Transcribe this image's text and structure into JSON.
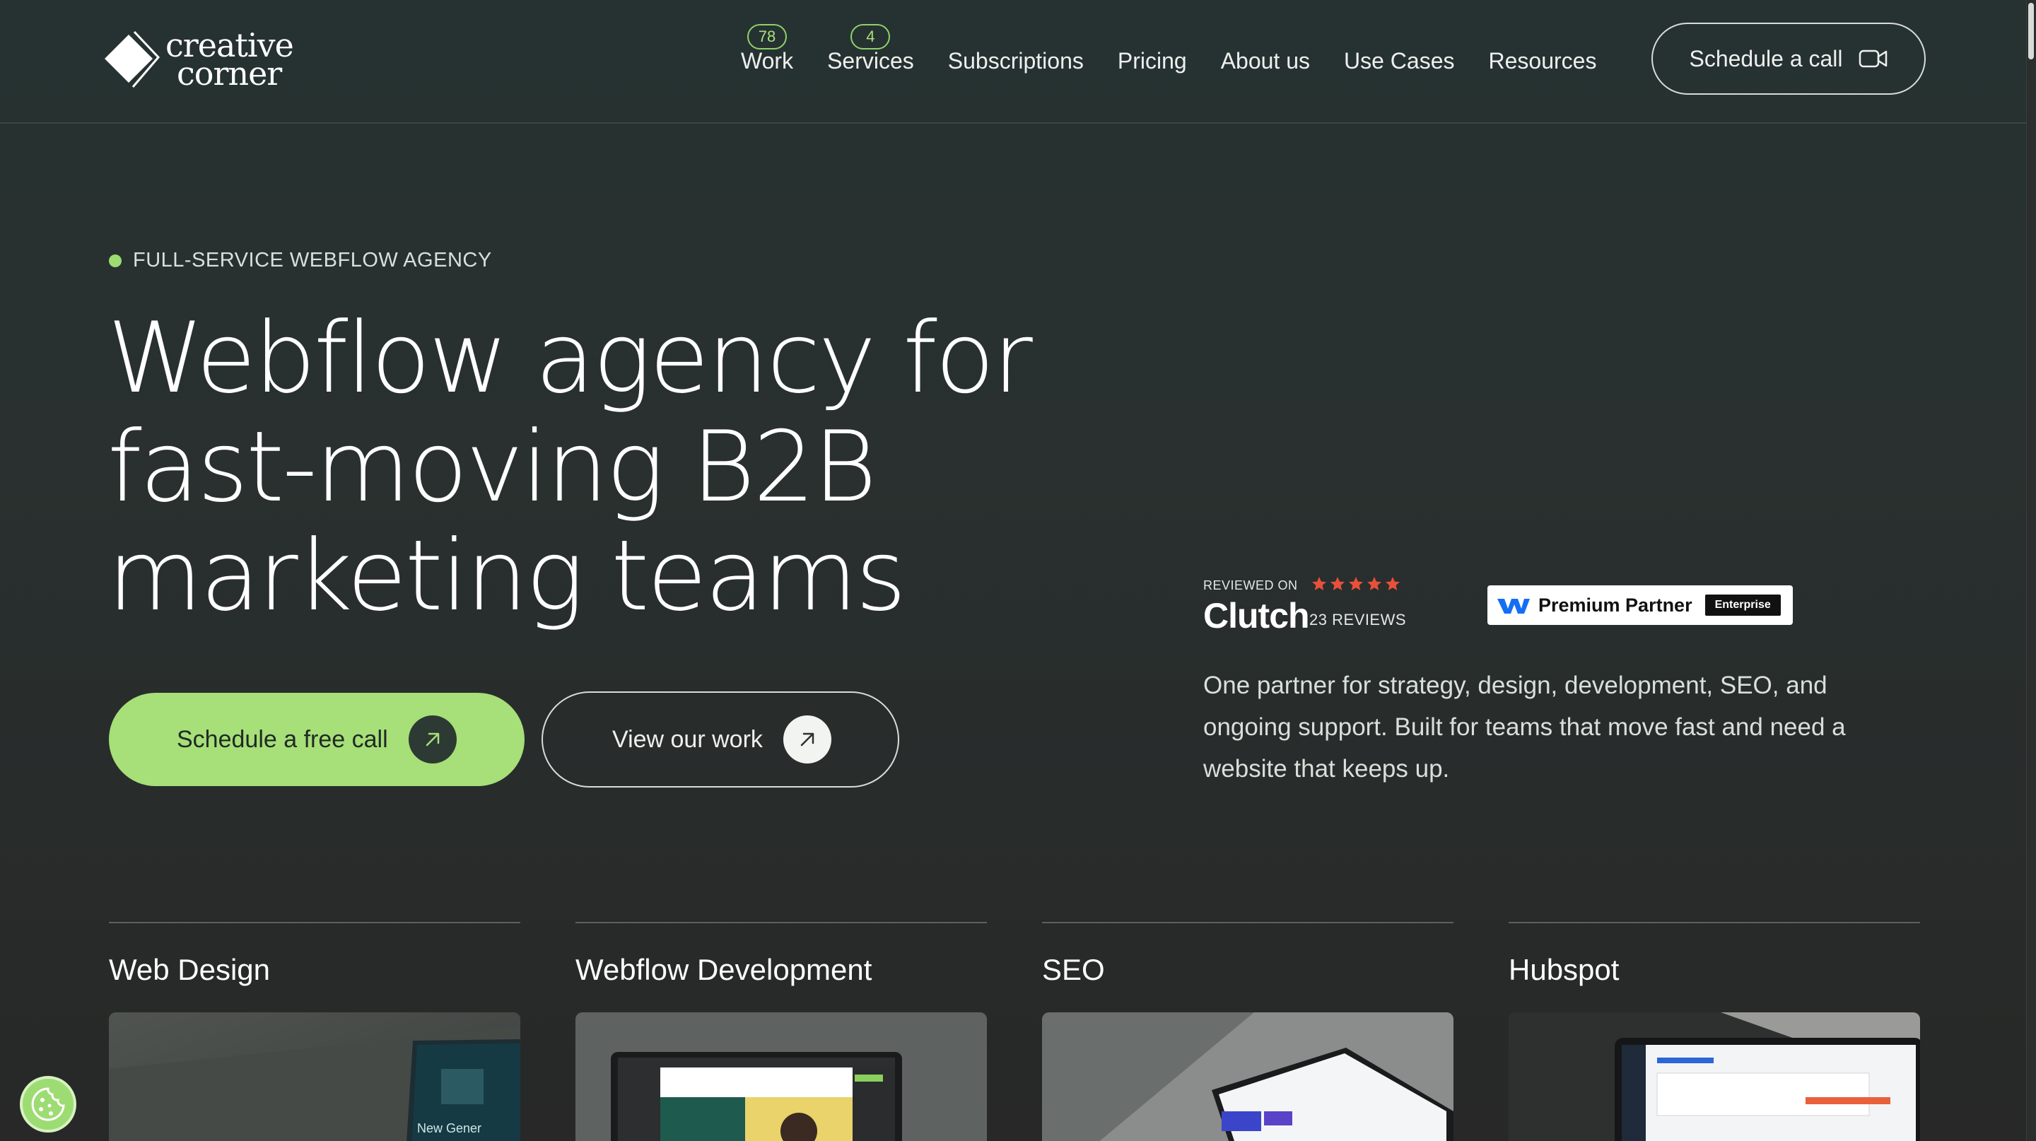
{
  "brand": {
    "line1": "creative",
    "line2": "corner"
  },
  "nav": {
    "items": [
      {
        "label": "Work",
        "badge": "78"
      },
      {
        "label": "Services",
        "badge": "4"
      },
      {
        "label": "Subscriptions",
        "badge": ""
      },
      {
        "label": "Pricing",
        "badge": ""
      },
      {
        "label": "About us",
        "badge": ""
      },
      {
        "label": "Use Cases",
        "badge": ""
      },
      {
        "label": "Resources",
        "badge": ""
      }
    ],
    "cta_label": "Schedule a call",
    "cta_icon": "video-camera-icon"
  },
  "hero": {
    "eyebrow": "FULL-SERVICE WEBFLOW AGENCY",
    "title_lines": [
      "Webflow agency for",
      "fast-moving B2B",
      "marketing teams"
    ],
    "primary_button": "Schedule a free call",
    "secondary_button": "View our work",
    "description": "One partner for strategy, design, development, SEO, and ongoing support. Built for teams that move fast and need a website that keeps up."
  },
  "clutch": {
    "reviewed_on": "REVIEWED ON",
    "name": "Clutch",
    "reviews": "23 REVIEWS",
    "stars": 5
  },
  "partner_badge": {
    "label": "Premium Partner",
    "tag": "Enterprise"
  },
  "services": [
    {
      "title": "Web Design"
    },
    {
      "title": "Webflow Development"
    },
    {
      "title": "SEO"
    },
    {
      "title": "Hubspot"
    }
  ],
  "colors": {
    "accent_green": "#a7df78",
    "background": "#272a29",
    "star_red": "#e8503a"
  }
}
